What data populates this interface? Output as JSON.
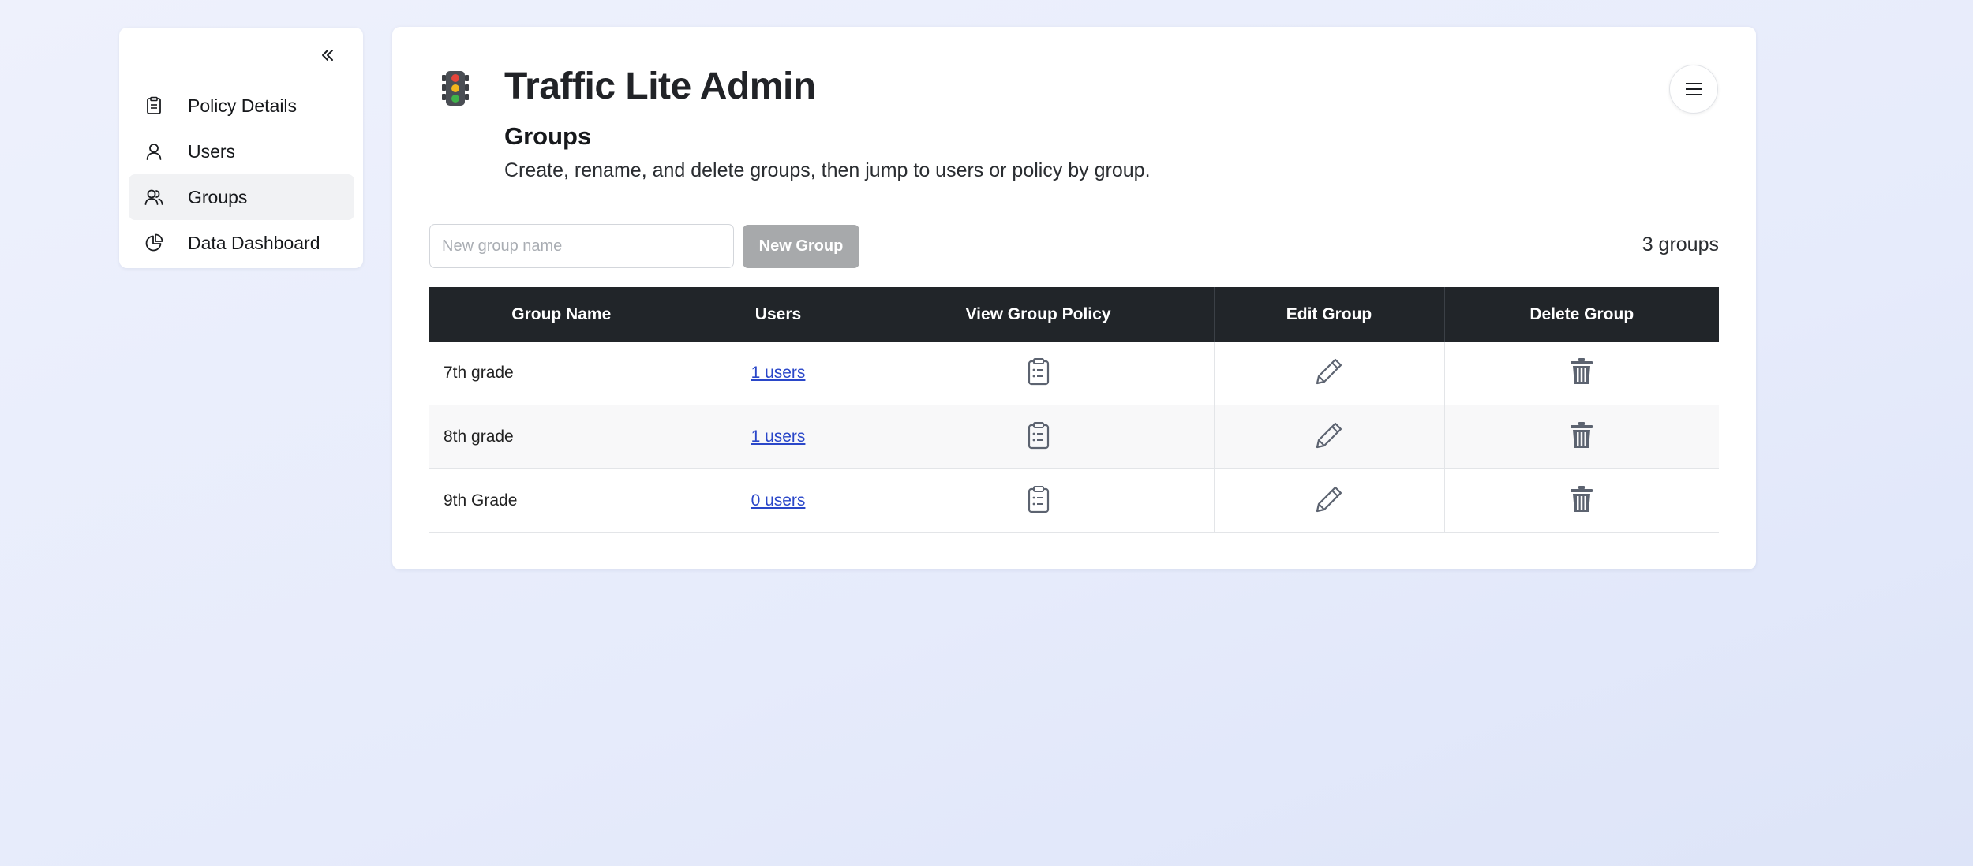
{
  "sidebar": {
    "collapse_icon": "double-chevron-left-icon",
    "items": [
      {
        "label": "Policy Details",
        "icon": "clipboard-icon",
        "active": false
      },
      {
        "label": "Users",
        "icon": "user-icon",
        "active": false
      },
      {
        "label": "Groups",
        "icon": "users-icon",
        "active": true
      },
      {
        "label": "Data Dashboard",
        "icon": "pie-chart-icon",
        "active": false
      }
    ]
  },
  "header": {
    "app_title": "Traffic Lite Admin",
    "logo_icon": "traffic-light-icon",
    "menu_icon": "hamburger-menu-icon"
  },
  "page": {
    "title": "Groups",
    "description": "Create, rename, and delete groups, then jump to users or policy by group."
  },
  "toolbar": {
    "new_group_placeholder": "New group name",
    "new_group_value": "",
    "new_group_button": "New Group",
    "group_count": "3 groups"
  },
  "table": {
    "columns": [
      "Group Name",
      "Users",
      "View Group Policy",
      "Edit Group",
      "Delete Group"
    ],
    "rows": [
      {
        "name": "7th grade",
        "users": "1 users"
      },
      {
        "name": "8th grade",
        "users": "1 users"
      },
      {
        "name": "9th Grade",
        "users": "0 users"
      }
    ]
  },
  "colors": {
    "header_bg": "#212529",
    "link": "#2a47c9",
    "button_disabled": "#a7a9ab",
    "icon_gray": "#5c6370"
  }
}
